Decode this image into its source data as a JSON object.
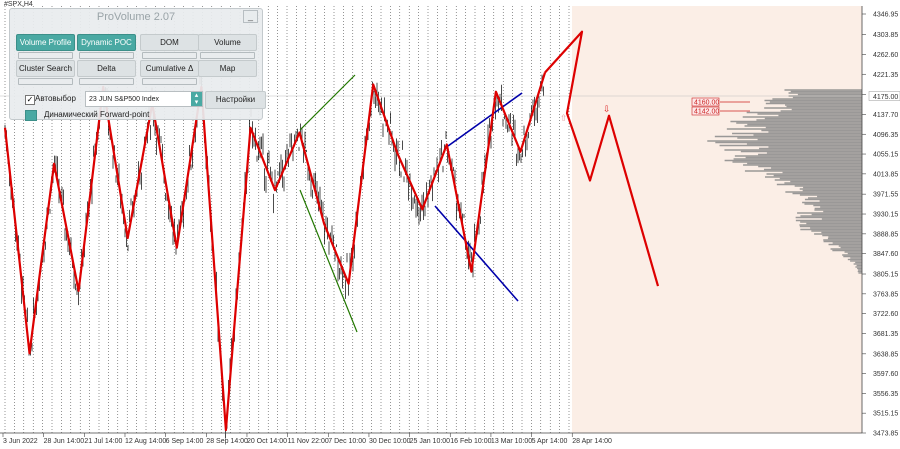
{
  "symbol": "#SPX,H4",
  "panel": {
    "title": "ProVolume 2.07",
    "minimize_label": "_",
    "buttons": [
      {
        "label": "Volume Profile",
        "active": true
      },
      {
        "label": "Dynamic POC",
        "active": true
      },
      {
        "label": "DOM",
        "active": false
      },
      {
        "label": "Volume",
        "active": false
      },
      {
        "label": "Cluster Search",
        "active": false
      },
      {
        "label": "Delta",
        "active": false
      },
      {
        "label": "Cumulative Δ",
        "active": false
      },
      {
        "label": "Map",
        "active": false
      }
    ],
    "auto_select_label": "Автовыбор",
    "auto_select_checked": true,
    "instrument": "23 JUN S&P500 Index",
    "settings_label": "Настройки",
    "forward_point_label": "Динамический Forward-point"
  },
  "chart_data": {
    "type": "line",
    "price_axis": [
      "4346.95",
      "4303.85",
      "4262.60",
      "4221.35",
      "4179.65",
      "4137.70",
      "4096.35",
      "4055.15",
      "4013.85",
      "3971.55",
      "3930.15",
      "3888.85",
      "3847.60",
      "3805.15",
      "3763.85",
      "3722.60",
      "3681.35",
      "3638.85",
      "3597.60",
      "3556.35",
      "3515.15",
      "3473.85"
    ],
    "ylim": [
      3473.85,
      4346.95
    ],
    "current_price": "4175.00",
    "price_boxes": [
      "4160.00",
      "4142.00"
    ],
    "date_axis": [
      "3 Jun 2022",
      "28 Jun 14:00",
      "21 Jul 14:00",
      "12 Aug 14:00",
      "6 Sep 14:00",
      "28 Sep 14:00",
      "20 Oct 14:00",
      "11 Nov 22:00",
      "7 Dec 10:00",
      "30 Dec 10:00",
      "25 Jan 10:00",
      "16 Feb 10:00",
      "13 Mar 10:00",
      "5 Apr 14:00",
      "28 Apr 14:00"
    ],
    "zigzag": [
      4110,
      3640,
      4035,
      3770,
      4195,
      3880,
      4160,
      3860,
      4195,
      3480,
      4110,
      3980,
      4100,
      3910,
      3785,
      4200,
      4055,
      3940,
      4075,
      3810,
      4185,
      4060,
      4225
    ],
    "forecast": [
      4310,
      4140,
      4000,
      4135,
      3780
    ],
    "colors": {
      "zigzag": "#dd0000",
      "upper_channel": "#0000aa",
      "green_channel": "#227700",
      "profile": "#8a8a8a"
    }
  }
}
